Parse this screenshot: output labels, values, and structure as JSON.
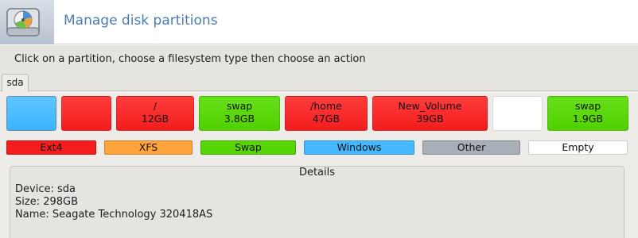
{
  "header": {
    "title": "Manage disk partitions",
    "icon": "hard-disk-pie-icon"
  },
  "instruction": "Click on a partition, choose a filesystem type then choose an action",
  "tabs": [
    {
      "label": "sda",
      "selected": true
    }
  ],
  "partitions": [
    {
      "name": "",
      "size": "",
      "type": "Windows",
      "color": "#3bb4ff"
    },
    {
      "name": "",
      "size": "",
      "type": "Ext4",
      "color": "#f21d1d"
    },
    {
      "name": "/",
      "size": "12GB",
      "type": "Ext4",
      "color": "#f21d1d"
    },
    {
      "name": "swap",
      "size": "3.8GB",
      "type": "Swap",
      "color": "#51d100"
    },
    {
      "name": "/home",
      "size": "47GB",
      "type": "Ext4",
      "color": "#f21d1d"
    },
    {
      "name": "New_Volume",
      "size": "39GB",
      "type": "Ext4",
      "color": "#f21d1d"
    },
    {
      "name": "",
      "size": "",
      "type": "Empty",
      "color": "#ffffff"
    },
    {
      "name": "swap",
      "size": "1.9GB",
      "type": "Swap",
      "color": "#51d100"
    }
  ],
  "legend": [
    {
      "label": "Ext4",
      "color": "#f51c1c"
    },
    {
      "label": "XFS",
      "color": "#ffa33a"
    },
    {
      "label": "Swap",
      "color": "#58d506"
    },
    {
      "label": "Windows",
      "color": "#44b9ff"
    },
    {
      "label": "Other",
      "color": "#a9afb8"
    },
    {
      "label": "Empty",
      "color": "#ffffff"
    }
  ],
  "details": {
    "title": "Details",
    "device": "Device: sda",
    "size": "Size: 298GB",
    "name": "Name: Seagate Technology 320418AS"
  }
}
